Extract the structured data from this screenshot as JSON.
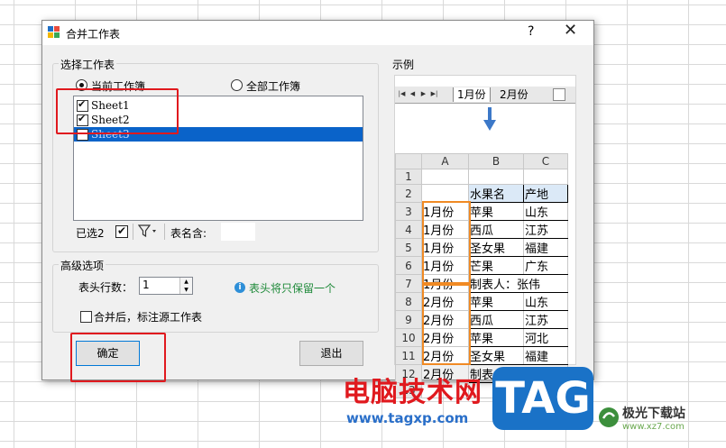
{
  "dialog": {
    "title": "合并工作表",
    "help": "?",
    "close": "✕"
  },
  "select_group": {
    "title": "选择工作表",
    "radio_current": "当前工作簿",
    "radio_all": "全部工作簿",
    "current_selected": true,
    "sheets": [
      {
        "label": "Sheet1",
        "checked": true,
        "selected": false
      },
      {
        "label": "Sheet2",
        "checked": true,
        "selected": false
      },
      {
        "label": "Sheet3",
        "checked": false,
        "selected": true
      }
    ],
    "selected_count_label": "已选2",
    "filter_icon": "filter-icon",
    "name_contains_label": "表名含:",
    "name_contains_value": ""
  },
  "advanced_group": {
    "title": "高级选项",
    "header_rows_label": "表头行数：",
    "header_rows_value": "1",
    "info_text": "表头将只保留一个",
    "mark_source_label": "合并后，标注源工作表",
    "mark_source_checked": false
  },
  "buttons": {
    "ok": "确定",
    "exit": "退出"
  },
  "preview": {
    "title": "示例",
    "tabs": [
      "1月份",
      "2月份"
    ],
    "col_headers": [
      "A",
      "B",
      "C"
    ],
    "rows": [
      {
        "n": "1",
        "a": "",
        "b": "",
        "c": ""
      },
      {
        "n": "2",
        "a": "",
        "b": "水果名",
        "c": "产地"
      },
      {
        "n": "3",
        "a": "1月份",
        "b": "苹果",
        "c": "山东"
      },
      {
        "n": "4",
        "a": "1月份",
        "b": "西瓜",
        "c": "江苏"
      },
      {
        "n": "5",
        "a": "1月份",
        "b": "圣女果",
        "c": "福建"
      },
      {
        "n": "6",
        "a": "1月份",
        "b": "芒果",
        "c": "广东"
      },
      {
        "n": "7",
        "a": "1月份",
        "b": "制表人：张伟",
        "c": ""
      },
      {
        "n": "8",
        "a": "2月份",
        "b": "苹果",
        "c": "山东"
      },
      {
        "n": "9",
        "a": "2月份",
        "b": "西瓜",
        "c": "江苏"
      },
      {
        "n": "10",
        "a": "2月份",
        "b": "苹果",
        "c": "河北"
      },
      {
        "n": "11",
        "a": "2月份",
        "b": "圣女果",
        "c": "福建"
      },
      {
        "n": "12",
        "a": "2月份",
        "b": "制表人：李四",
        "c": ""
      },
      {
        "n": "13",
        "a": "",
        "b": "",
        "c": ""
      }
    ]
  },
  "watermark": {
    "title": "电脑技术网",
    "url": "www.tagxp.com",
    "tag": "TAG",
    "site_cn": "极光下载站",
    "site_en": "www.xz7.com"
  },
  "colors": {
    "selection": "#0a63c9",
    "highlight_red": "#e0191e",
    "highlight_orange": "#f08a24",
    "header_blue": "#dbe9f7"
  }
}
